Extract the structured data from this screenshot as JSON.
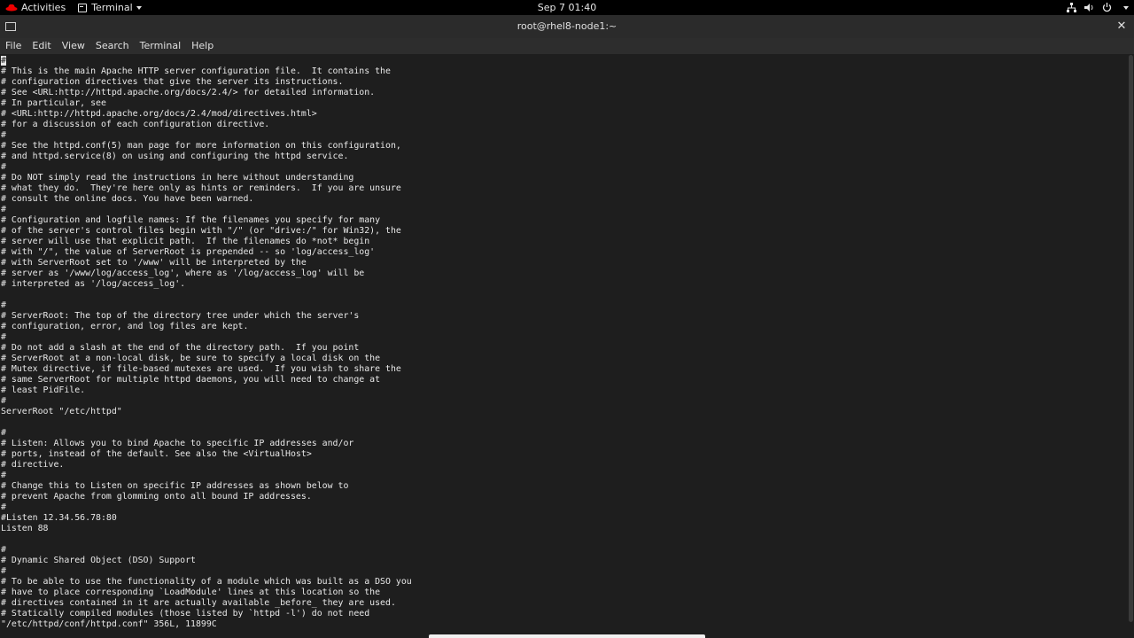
{
  "topbar": {
    "activities": "Activities",
    "app_menu": "Terminal",
    "clock": "Sep 7  01:40"
  },
  "window": {
    "title": "root@rhel8-node1:~"
  },
  "menu": [
    "File",
    "Edit",
    "View",
    "Search",
    "Terminal",
    "Help"
  ],
  "terminal": {
    "first_line_rest": "",
    "lines": [
      "#",
      "# This is the main Apache HTTP server configuration file.  It contains the",
      "# configuration directives that give the server its instructions.",
      "# See <URL:http://httpd.apache.org/docs/2.4/> for detailed information.",
      "# In particular, see",
      "# <URL:http://httpd.apache.org/docs/2.4/mod/directives.html>",
      "# for a discussion of each configuration directive.",
      "#",
      "# See the httpd.conf(5) man page for more information on this configuration,",
      "# and httpd.service(8) on using and configuring the httpd service.",
      "#",
      "# Do NOT simply read the instructions in here without understanding",
      "# what they do.  They're here only as hints or reminders.  If you are unsure",
      "# consult the online docs. You have been warned.",
      "#",
      "# Configuration and logfile names: If the filenames you specify for many",
      "# of the server's control files begin with \"/\" (or \"drive:/\" for Win32), the",
      "# server will use that explicit path.  If the filenames do *not* begin",
      "# with \"/\", the value of ServerRoot is prepended -- so 'log/access_log'",
      "# with ServerRoot set to '/www' will be interpreted by the",
      "# server as '/www/log/access_log', where as '/log/access_log' will be",
      "# interpreted as '/log/access_log'.",
      "",
      "#",
      "# ServerRoot: The top of the directory tree under which the server's",
      "# configuration, error, and log files are kept.",
      "#",
      "# Do not add a slash at the end of the directory path.  If you point",
      "# ServerRoot at a non-local disk, be sure to specify a local disk on the",
      "# Mutex directive, if file-based mutexes are used.  If you wish to share the",
      "# same ServerRoot for multiple httpd daemons, you will need to change at",
      "# least PidFile.",
      "#",
      "ServerRoot \"/etc/httpd\"",
      "",
      "#",
      "# Listen: Allows you to bind Apache to specific IP addresses and/or",
      "# ports, instead of the default. See also the <VirtualHost>",
      "# directive.",
      "#",
      "# Change this to Listen on specific IP addresses as shown below to",
      "# prevent Apache from glomming onto all bound IP addresses.",
      "#",
      "#Listen 12.34.56.78:80",
      "Listen 88",
      "",
      "#",
      "# Dynamic Shared Object (DSO) Support",
      "#",
      "# To be able to use the functionality of a module which was built as a DSO you",
      "# have to place corresponding `LoadModule' lines at this location so the",
      "# directives contained in it are actually available _before_ they are used.",
      "# Statically compiled modules (those listed by `httpd -l') do not need",
      "\"/etc/httpd/conf/httpd.conf\" 356L, 11899C"
    ]
  }
}
